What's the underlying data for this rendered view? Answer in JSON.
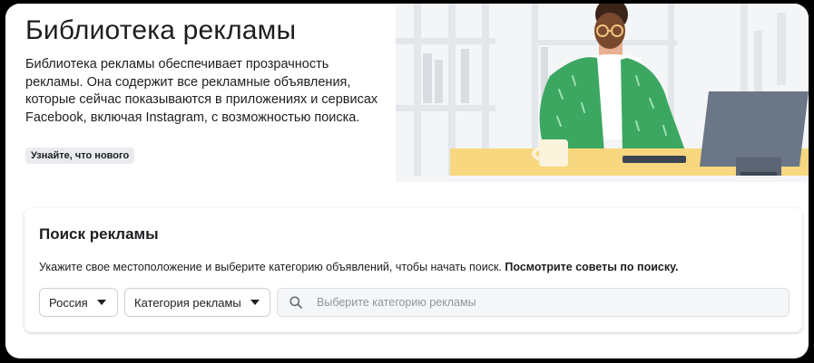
{
  "hero": {
    "title": "Библиотека рекламы",
    "description": "Библиотека рекламы обеспечивает прозрачность рекламы. Она содержит все рекламные объявления, которые сейчас показываются в приложениях и сервисах Facebook, включая Instagram, с возможностью поиска.",
    "whats_new_label": "Узнайте, что нового"
  },
  "search": {
    "title": "Поиск рекламы",
    "hint": "Укажите свое местоположение и выберите категорию объявлений, чтобы начать поиск.",
    "tips_link": "Посмотрите советы по поиску.",
    "country_value": "Россия",
    "category_value": "Категория рекламы",
    "input_placeholder": "Выберите категорию рекламы"
  },
  "colors": {
    "text": "#1c1e21",
    "placeholder": "#90949c",
    "input_bg": "#f5f6f7",
    "jacket": "#3ba760",
    "desk": "#f7d77f",
    "laptop": "#6b7787"
  }
}
